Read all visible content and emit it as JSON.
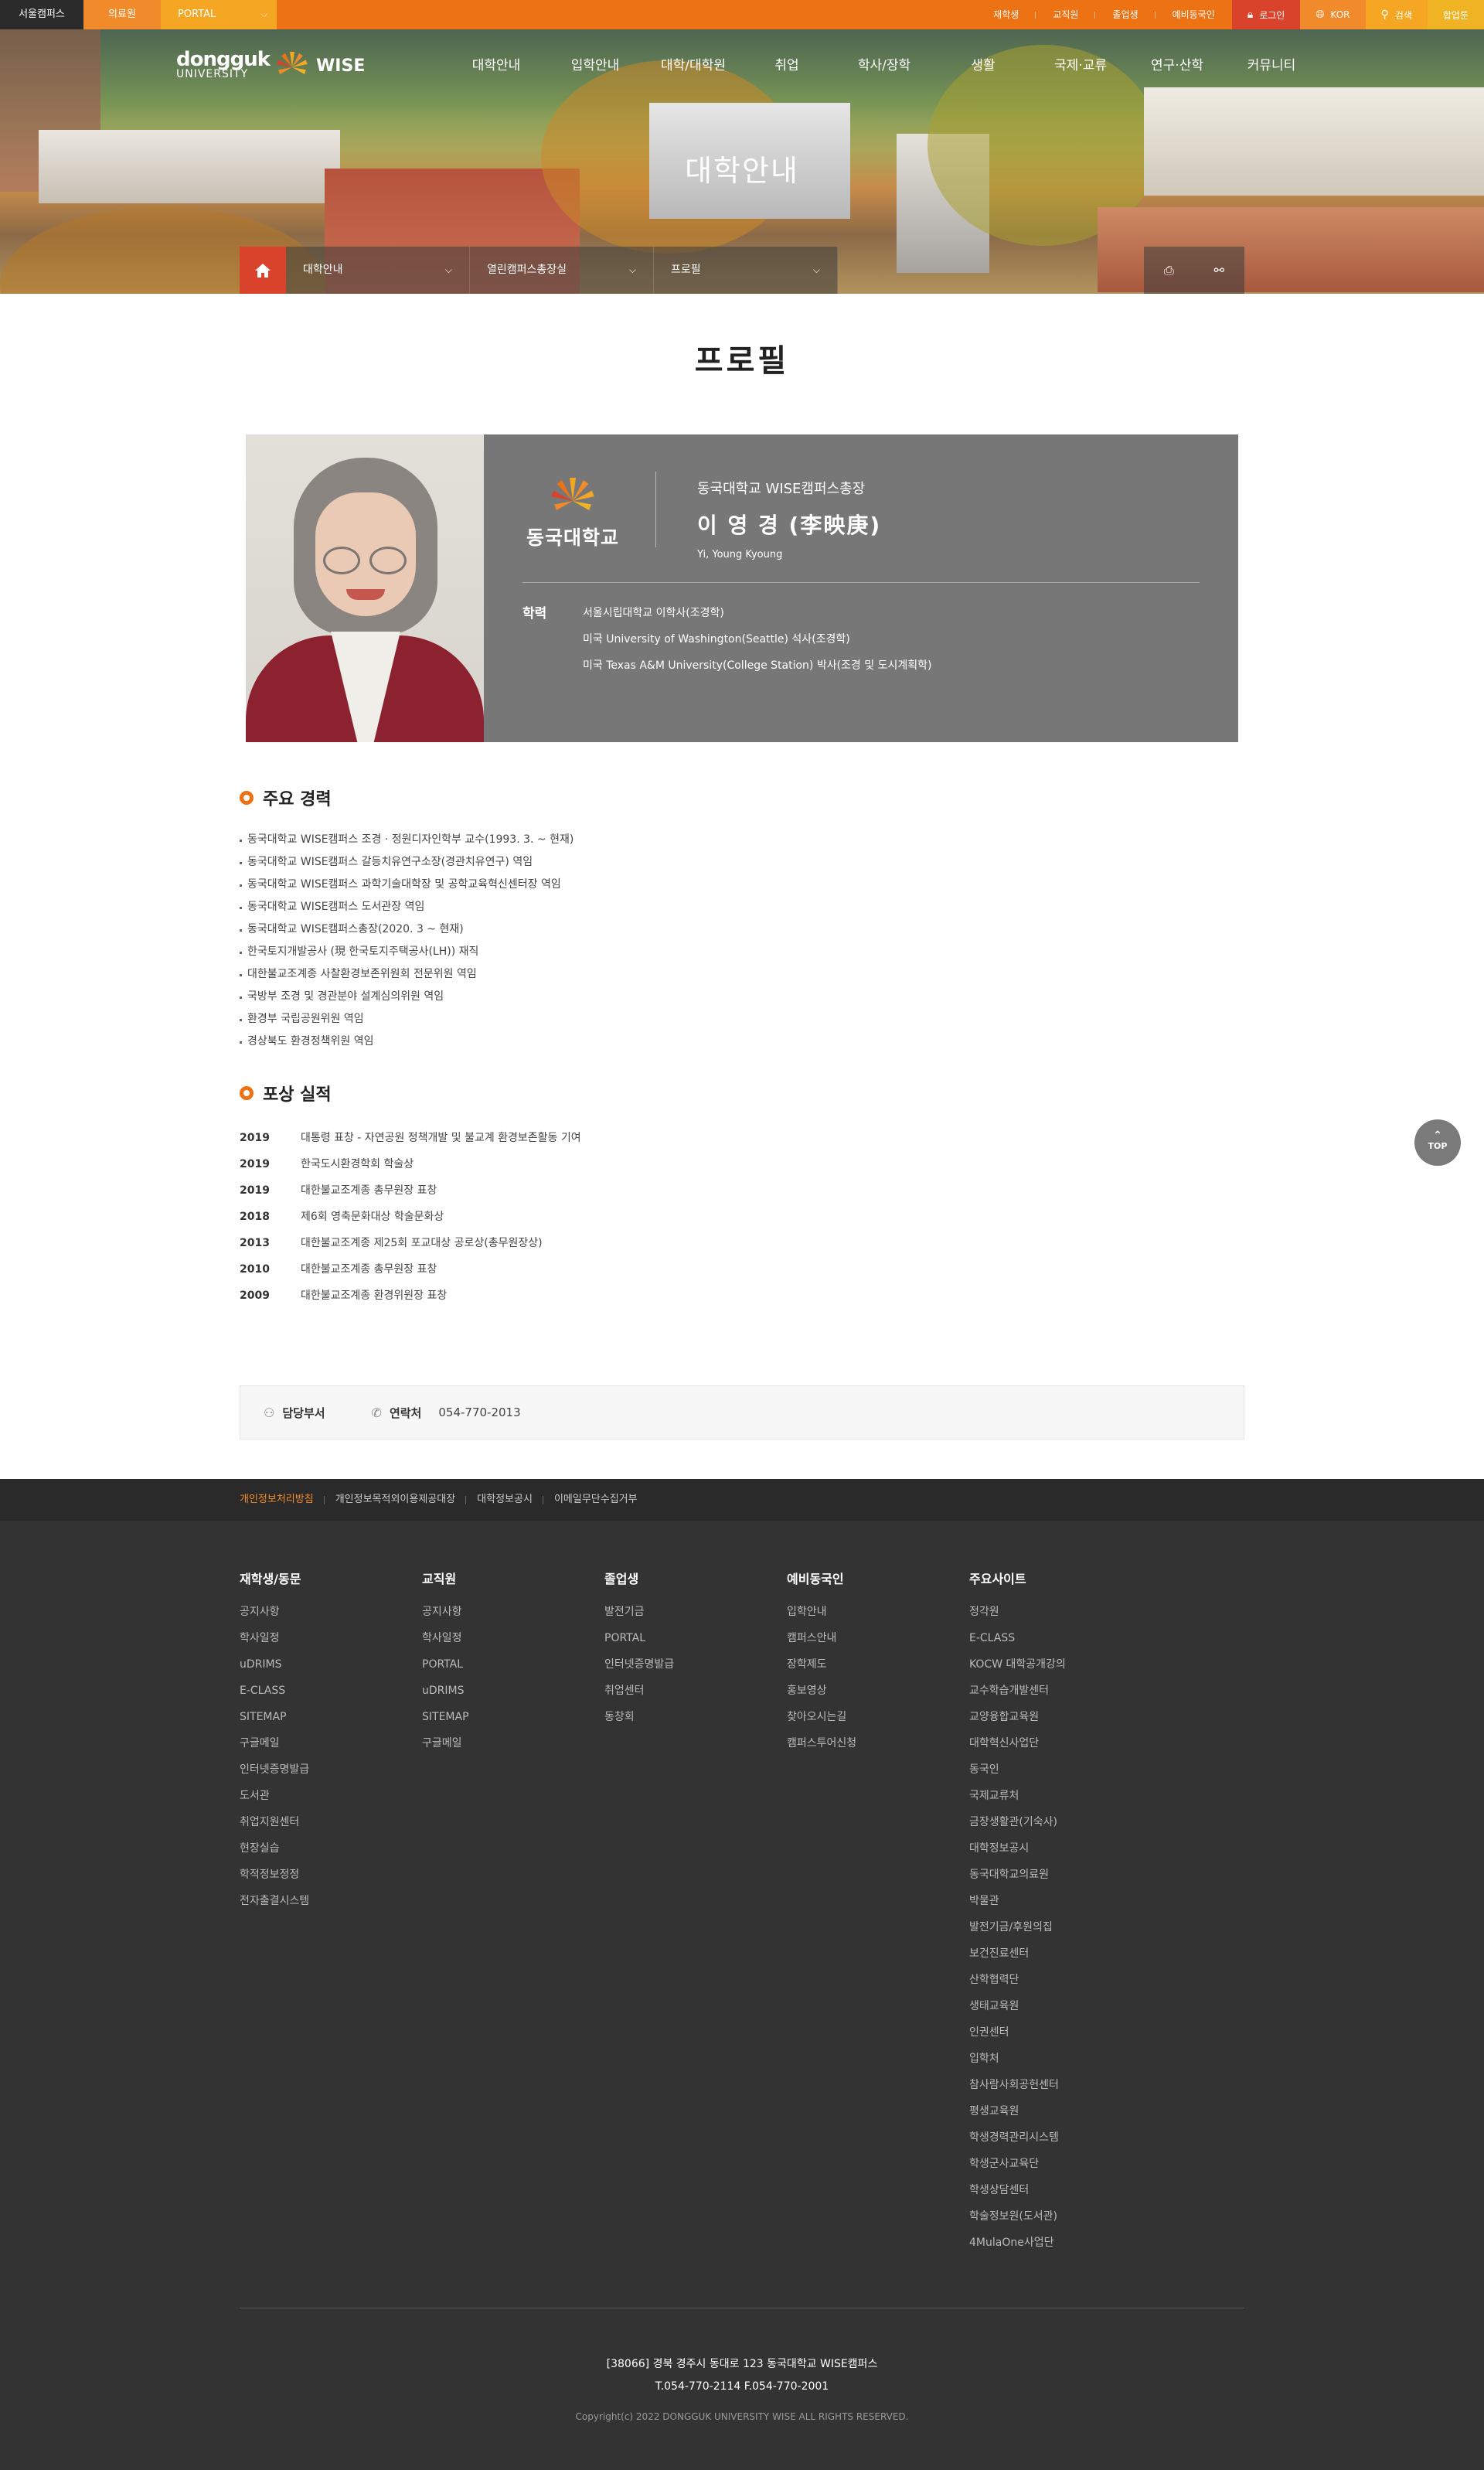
{
  "utility": {
    "seoul": "서울캠퍼스",
    "medical": "의료원",
    "portal": "PORTAL",
    "links": [
      "재학생",
      "교직원",
      "졸업생",
      "예비동국인"
    ],
    "login": "로그인",
    "lang": "KOR",
    "search": "검색",
    "enter": "합업툰"
  },
  "logo": {
    "top": "dongguk",
    "bottom": "UNIVERSITY",
    "brand": "WISE"
  },
  "gnb": [
    "대학안내",
    "입학안내",
    "대학/대학원",
    "취업",
    "학사/장학",
    "생활",
    "국제·교류",
    "연구·산학",
    "커뮤니티"
  ],
  "hero": {
    "title": "대학안내"
  },
  "breadcrumb": [
    "대학안내",
    "열린캠퍼스총장실",
    "프로필"
  ],
  "page_title": "프로필",
  "profile": {
    "logo_name": "동국대학교",
    "position": "동국대학교 WISE캠퍼스총장",
    "name": "이 영 경 (李映庚)",
    "name_en": "Yi, Young Kyoung",
    "edu_label": "학력",
    "education": [
      "서울시립대학교 이학사(조경학)",
      "미국 University of Washington(Seattle) 석사(조경학)",
      "미국 Texas A&M University(College Station) 박사(조경 및 도시계획학)"
    ]
  },
  "career": {
    "title": "주요 경력",
    "items": [
      "동국대학교 WISE캠퍼스 조경 · 정원디자인학부 교수(1993. 3. ~ 현재)",
      "동국대학교 WISE캠퍼스 갈등치유연구소장(경관치유연구) 역임",
      "동국대학교 WISE캠퍼스 과학기술대학장 및 공학교육혁신센터장 역임",
      "동국대학교 WISE캠퍼스 도서관장 역임",
      "동국대학교 WISE캠퍼스총장(2020. 3 ~ 현재)",
      "한국토지개발공사 (現 한국토지주택공사(LH)) 재직",
      "대한불교조계종 사찰환경보존위원회 전문위원 역임",
      "국방부 조경 및 경관분야 설계심의위원 역임",
      "환경부 국립공원위원 역임",
      "경상북도 환경정책위원 역임"
    ]
  },
  "awards": {
    "title": "포상 실적",
    "items": [
      {
        "year": "2019",
        "text": "대통령 표창 - 자연공원 정책개발 및 불교계 환경보존활동 기여"
      },
      {
        "year": "2019",
        "text": "한국도시환경학회 학술상"
      },
      {
        "year": "2019",
        "text": "대한불교조계종 총무원장 표창"
      },
      {
        "year": "2018",
        "text": "제6회 영축문화대상 학술문화상"
      },
      {
        "year": "2013",
        "text": "대한불교조계종 제25회 포교대상 공로상(총무원장상)"
      },
      {
        "year": "2010",
        "text": "대한불교조계종 총무원장 표창"
      },
      {
        "year": "2009",
        "text": "대한불교조계종 환경위원장 표창"
      }
    ]
  },
  "contact": {
    "dept_label": "담당부서",
    "dept_value": "",
    "tel_label": "연락처",
    "tel_value": "054-770-2013"
  },
  "top_button": "TOP",
  "footer": {
    "links": [
      "개인정보처리방침",
      "개인정보목적외이용제공대장",
      "대학정보공시",
      "이메일무단수집거부"
    ],
    "columns": [
      {
        "title": "재학생/동문",
        "items": [
          "공지사항",
          "학사일정",
          "uDRIMS",
          "E-CLASS",
          "SITEMAP",
          "구글메일",
          "인터넷증명발급",
          "도서관",
          "취업지원센터",
          "현장실습",
          "학적정보정정",
          "전자출결시스템"
        ]
      },
      {
        "title": "교직원",
        "items": [
          "공지사항",
          "학사일정",
          "PORTAL",
          "uDRIMS",
          "SITEMAP",
          "구글메일"
        ]
      },
      {
        "title": "졸업생",
        "items": [
          "발전기금",
          "PORTAL",
          "인터넷증명발급",
          "취업센터",
          "동창회"
        ]
      },
      {
        "title": "예비동국인",
        "items": [
          "입학안내",
          "캠퍼스안내",
          "장학제도",
          "홍보영상",
          "찾아오시는길",
          "캠퍼스투어신청"
        ]
      },
      {
        "title": "주요사이트",
        "items": [
          "정각원",
          "E-CLASS",
          "KOCW 대학공개강의",
          "교수학습개발센터",
          "교양융합교육원",
          "대학혁신사업단",
          "동국인",
          "국제교류처",
          "금장생활관(기숙사)",
          "대학정보공시",
          "동국대학교의료원",
          "박물관",
          "발전기금/후원의집",
          "보건진료센터",
          "산학협력단",
          "생태교육원",
          "인권센터",
          "입학처",
          "참사람사회공헌센터",
          "평생교육원",
          "학생경력관리시스템",
          "학생군사교육단",
          "학생상담센터",
          "학술정보원(도서관)",
          "4MulaOne사업단"
        ]
      }
    ],
    "address": "[38066] 경북 경주시 동대로 123 동국대학교 WISE캠퍼스",
    "tel": "T.054-770-2114 F.054-770-2001",
    "copyright": "Copyright(c) 2022 DONGGUK UNIVERSITY WISE ALL RIGHTS RESERVED."
  },
  "colors": {
    "accent": "#ed7213",
    "login": "#d9432b",
    "footer_bg": "#333333"
  }
}
